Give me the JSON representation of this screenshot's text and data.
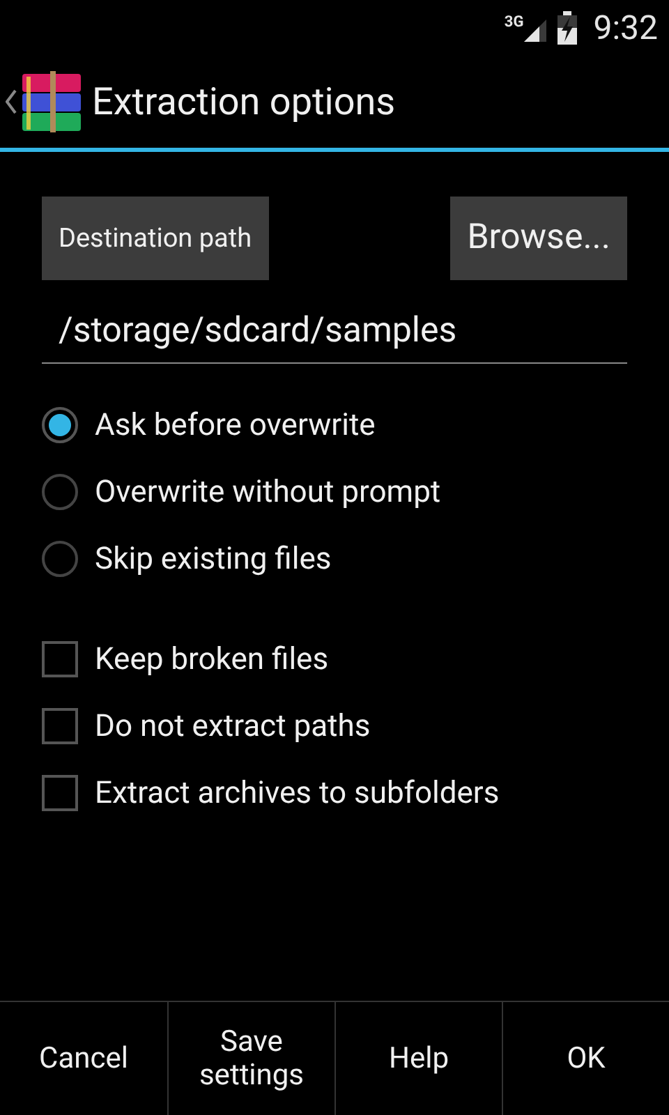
{
  "status_bar": {
    "network": "3G",
    "time": "9:32"
  },
  "action_bar": {
    "title": "Extraction options"
  },
  "destination": {
    "label_button": "Destination path",
    "browse_button": "Browse...",
    "path": "/storage/sdcard/samples"
  },
  "overwrite_options": [
    {
      "label": "Ask before overwrite",
      "selected": true
    },
    {
      "label": "Overwrite without prompt",
      "selected": false
    },
    {
      "label": "Skip existing files",
      "selected": false
    }
  ],
  "options": [
    {
      "label": "Keep broken files",
      "checked": false
    },
    {
      "label": "Do not extract paths",
      "checked": false
    },
    {
      "label": "Extract archives to subfolders",
      "checked": false
    }
  ],
  "buttons": [
    "Cancel",
    "Save settings",
    "Help",
    "OK"
  ]
}
